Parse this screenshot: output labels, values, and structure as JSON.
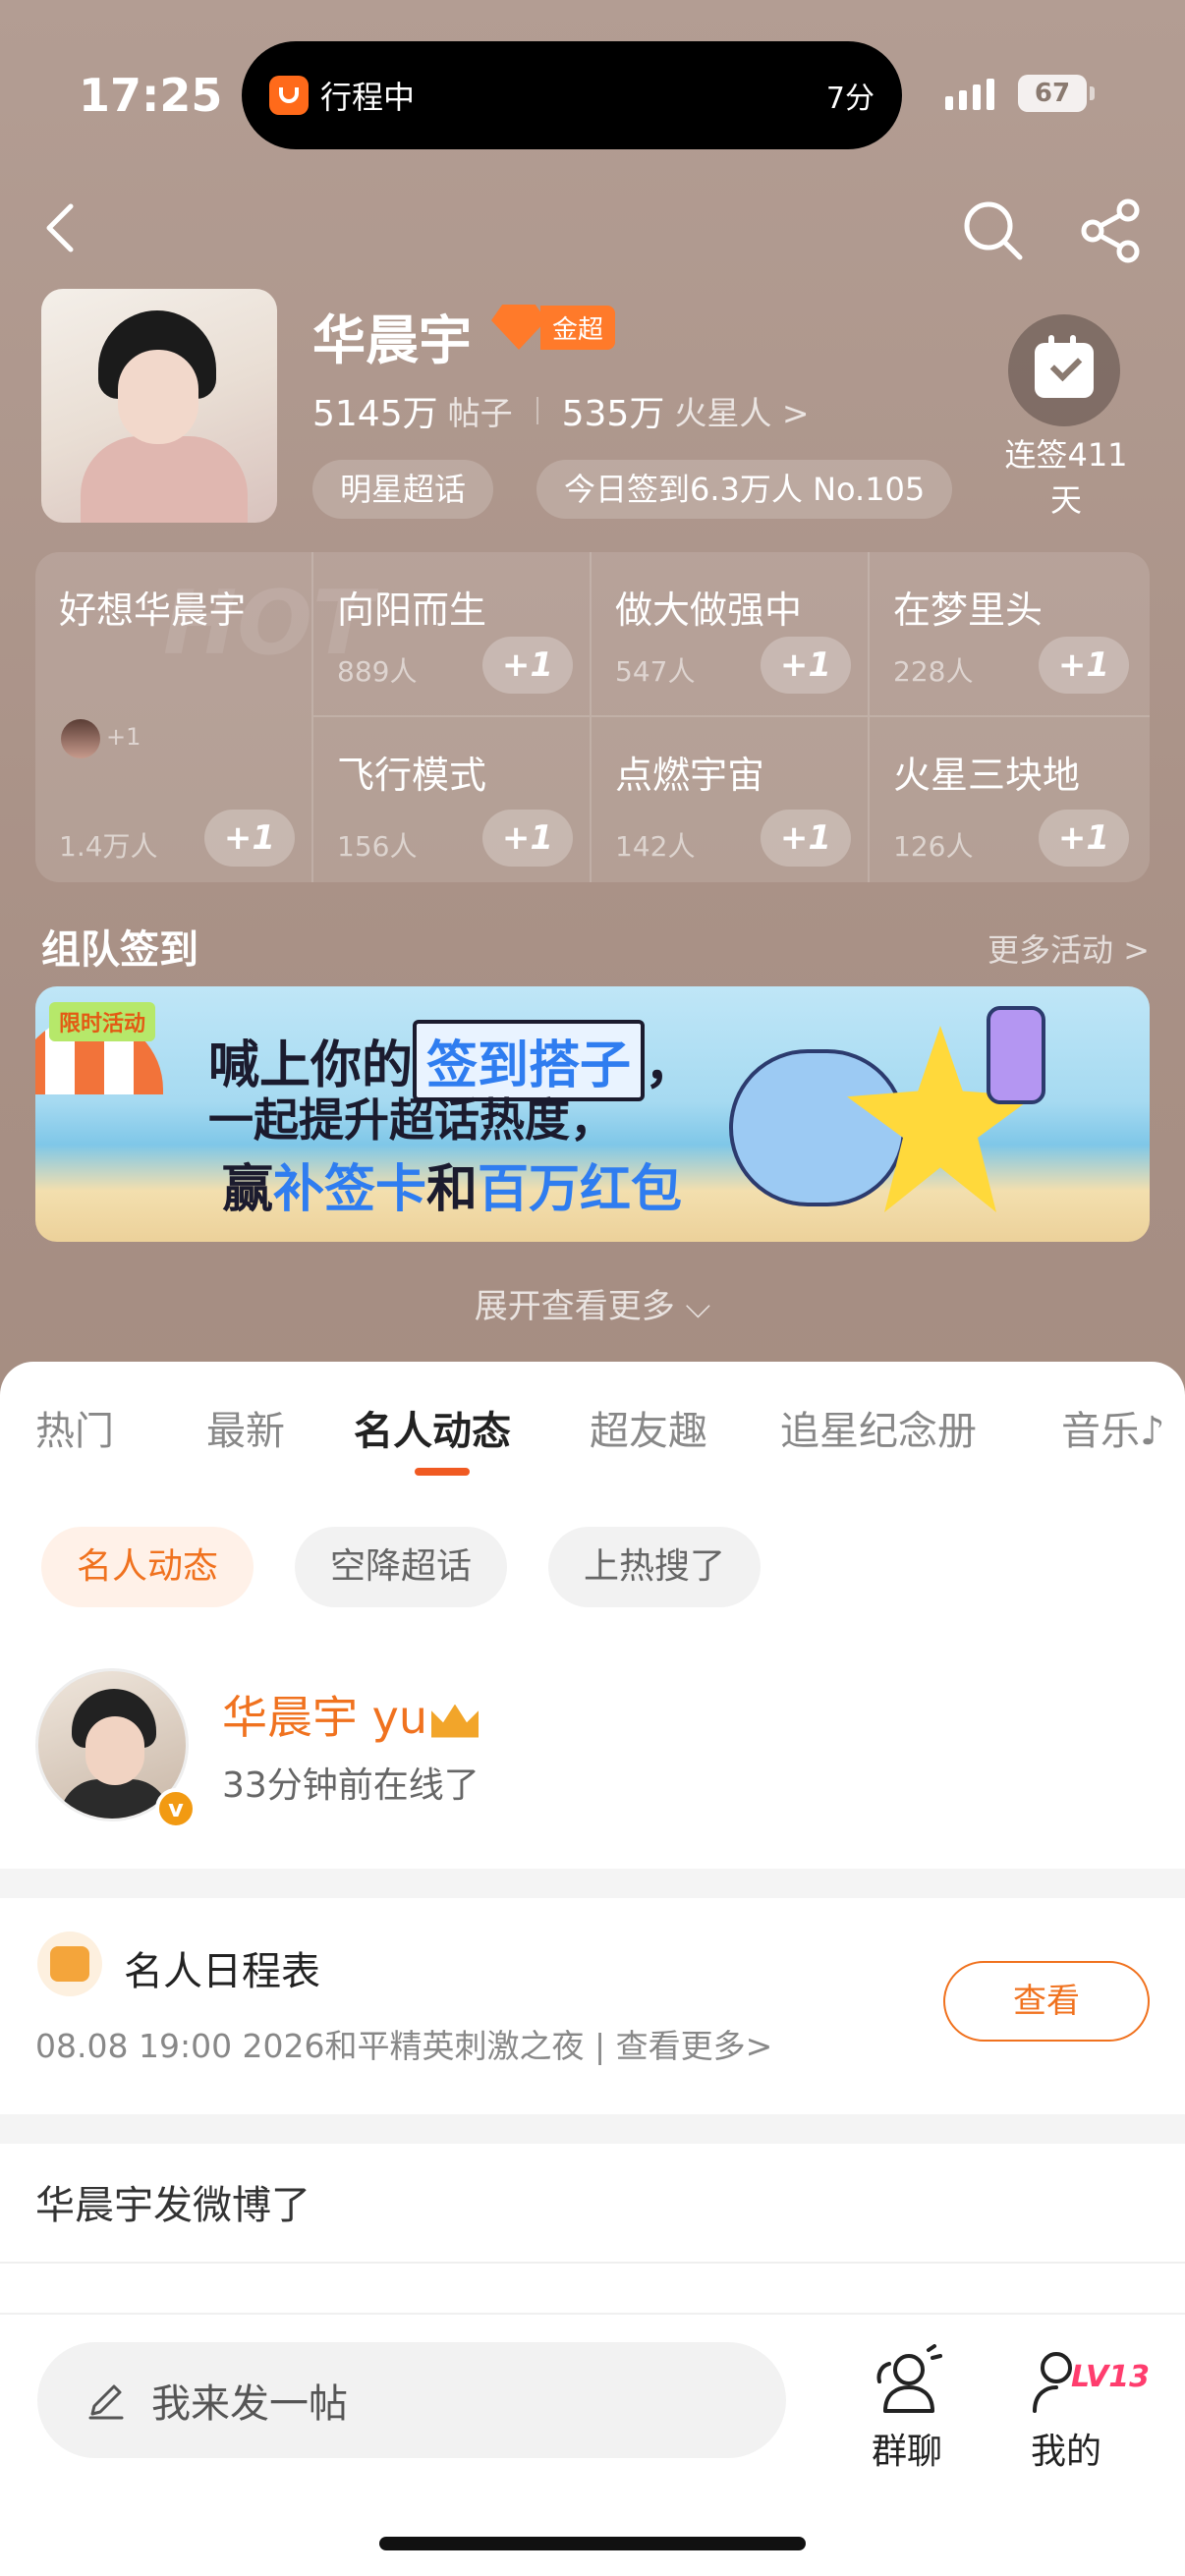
{
  "status_bar": {
    "time": "17:25",
    "island_text": "行程中",
    "island_right": "7分",
    "battery": "67"
  },
  "header": {
    "star_name": "华晨宇",
    "level_tag": "金超",
    "posts_value": "5145万",
    "posts_unit": "帖子",
    "fans_value": "535万",
    "fans_unit": "火星人 >",
    "chip_category": "明星超话",
    "chip_checkin": "今日签到6.3万人 No.105",
    "checkin_streak": "连签411天"
  },
  "groups": [
    {
      "title": "好想华晨宇",
      "count": "1.4万人",
      "plus": "+1"
    },
    {
      "title": "向阳而生",
      "count": "889人",
      "plus": "+1"
    },
    {
      "title": "做大做强中",
      "count": "547人",
      "plus": "+1"
    },
    {
      "title": "在梦里头",
      "count": "228人",
      "plus": "+1"
    },
    {
      "title": "飞行模式",
      "count": "156人",
      "plus": "+1"
    },
    {
      "title": "点燃宇宙",
      "count": "142人",
      "plus": "+1"
    },
    {
      "title": "火星三块地",
      "count": "126人",
      "plus": "+1"
    }
  ],
  "group_mini_plus": "+1",
  "hot_watermark": "HOT",
  "team": {
    "title": "组队签到",
    "more": "更多活动 >"
  },
  "banner": {
    "tag": "限时活动",
    "line1_a": "喊上你的",
    "line1_b": "签到搭子",
    "line1_c": "，",
    "line2": "一起提升超话热度，",
    "line3_a": "赢",
    "line3_b": "补签卡",
    "line3_c": "和",
    "line3_d": "百万红包"
  },
  "expand_text": "展开查看更多 ⌵",
  "tabs": [
    "热门",
    "最新",
    "名人动态",
    "超友趣",
    "追星纪念册",
    "音乐♪"
  ],
  "subtabs": [
    "名人动态",
    "空降超话",
    "上热搜了"
  ],
  "celebrity": {
    "name": "华晨宇 yu",
    "status": "33分钟前在线了",
    "verify": "v"
  },
  "schedule": {
    "title": "名人日程表",
    "info": "08.08 19:00 2026和平精英刺激之夜 |  查看更多>",
    "button": "查看"
  },
  "feed_title": "华晨宇发微博了",
  "bottom": {
    "compose_placeholder": "我来发一帖",
    "group_chat": "群聊",
    "mine": "我的",
    "level": "LV13"
  },
  "colors": {
    "accent": "#f0721f",
    "header_bg": "#a89085",
    "badge": "#ff7a2a"
  }
}
